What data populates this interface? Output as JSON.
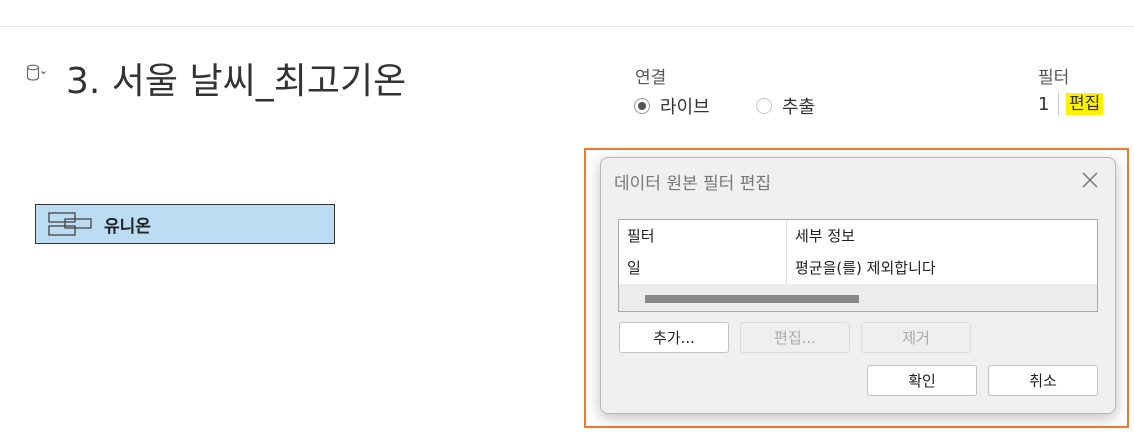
{
  "datasource": {
    "icon": "database-icon",
    "title": "3. 서울 날씨_최고기온"
  },
  "connection": {
    "label": "연결",
    "options": [
      {
        "label": "라이브",
        "selected": true
      },
      {
        "label": "추출",
        "selected": false
      }
    ]
  },
  "filters": {
    "label": "필터",
    "count": "1",
    "edit_label": "편집",
    "edit_highlight_color": "#fff200"
  },
  "canvas": {
    "table_label": "유니온",
    "table_icon": "union-table-icon",
    "table_color": "#bcdcf4"
  },
  "dialog": {
    "title": "데이터 원본 필터 편집",
    "table": {
      "headers": [
        "필터",
        "세부 정보"
      ],
      "rows": [
        [
          "일",
          "평균을(를) 제외합니다"
        ]
      ]
    },
    "buttons": {
      "add": "추가...",
      "edit": "편집...",
      "remove": "제거",
      "ok": "확인",
      "cancel": "취소"
    },
    "highlight_color": "#f07a2c"
  }
}
